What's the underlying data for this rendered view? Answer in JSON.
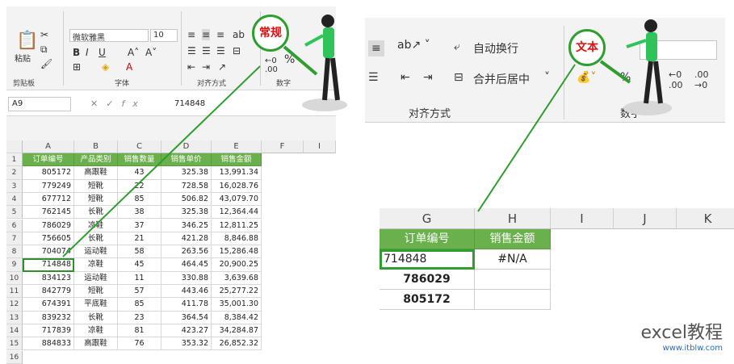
{
  "left": {
    "ribbon": {
      "paste_label": "粘贴",
      "clipboard_label": "剪贴板",
      "font_group_label": "字体",
      "align_group_label": "对齐方式",
      "number_group_label": "数字",
      "font_name": "微软雅黑",
      "font_size": "10"
    },
    "formula_bar": {
      "name_box": "A9",
      "value": "714848"
    },
    "columns": [
      "A",
      "B",
      "C",
      "D",
      "E",
      "F",
      "I"
    ],
    "headers": [
      "订单编号",
      "产品类别",
      "销售数量",
      "销售单价",
      "销售金额"
    ],
    "rows": [
      [
        "805172",
        "高跟鞋",
        "43",
        "325.38",
        "13,991.34"
      ],
      [
        "779249",
        "短靴",
        "22",
        "728.58",
        "16,028.76"
      ],
      [
        "677712",
        "短靴",
        "85",
        "506.82",
        "43,079.70"
      ],
      [
        "762145",
        "长靴",
        "38",
        "325.38",
        "12,364.44"
      ],
      [
        "786029",
        "凉鞋",
        "37",
        "346.25",
        "12,811.25"
      ],
      [
        "756605",
        "长靴",
        "21",
        "421.28",
        "8,846.88"
      ],
      [
        "704074",
        "运动鞋",
        "58",
        "263.56",
        "15,286.48"
      ],
      [
        "714848",
        "凉鞋",
        "45",
        "464.45",
        "20,900.25"
      ],
      [
        "834123",
        "运动鞋",
        "11",
        "330.88",
        "3,639.68"
      ],
      [
        "842779",
        "短靴",
        "57",
        "443.46",
        "25,277.22"
      ],
      [
        "674391",
        "平底鞋",
        "85",
        "411.78",
        "35,001.30"
      ],
      [
        "839232",
        "长靴",
        "23",
        "364.54",
        "8,384.42"
      ],
      [
        "717839",
        "凉鞋",
        "81",
        "423.27",
        "34,284.87"
      ],
      [
        "884833",
        "高跟鞋",
        "76",
        "353.32",
        "26,852.32"
      ]
    ],
    "row_numbers": [
      "1",
      "2",
      "3",
      "4",
      "5",
      "6",
      "7",
      "8",
      "9",
      "10",
      "11",
      "12",
      "13",
      "14",
      "15",
      "16"
    ],
    "badge": "常规"
  },
  "right": {
    "ribbon": {
      "wrap_text": "自动换行",
      "merge_center": "合并后居中",
      "align_group_label": "对齐方式",
      "number_group_label": "数字"
    },
    "columns": [
      "G",
      "H",
      "I",
      "J",
      "K"
    ],
    "headers": [
      "订单编号",
      "销售金额"
    ],
    "rows": [
      [
        "714848",
        "#N/A"
      ],
      [
        "786029",
        ""
      ],
      [
        "805172",
        ""
      ]
    ],
    "badge": "文本"
  },
  "watermark": {
    "main": "excel教程",
    "sub": "www.itblw.com"
  },
  "colors": {
    "green_header": "#6ab04c",
    "highlight": "#2f9e2f",
    "badge_text": "#dd1111"
  }
}
